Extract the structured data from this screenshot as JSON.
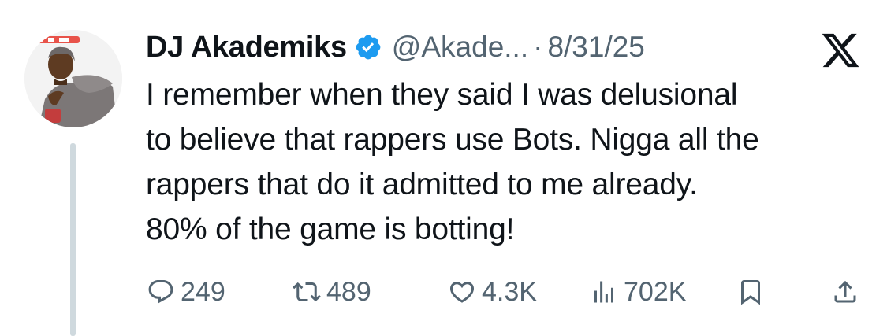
{
  "author": {
    "display_name": "DJ Akademiks",
    "handle": "@Akade...",
    "verified": true,
    "verified_color": "#1d9bf0"
  },
  "meta": {
    "separator": "·",
    "date": "8/31/25"
  },
  "platform": {
    "logo_icon": "x-logo-icon"
  },
  "tweet": {
    "lines": [
      "I remember when they said I was delusional",
      "to believe that rappers use Bots. Nigga all the",
      "rappers that do it admitted to me already.",
      "80% of the game is botting!"
    ]
  },
  "actions": {
    "replies": "249",
    "reposts": "489",
    "likes": "4.3K",
    "views": "702K"
  },
  "colors": {
    "text": "#0f1419",
    "secondary": "#536471",
    "thread_line": "#cfd9de"
  }
}
